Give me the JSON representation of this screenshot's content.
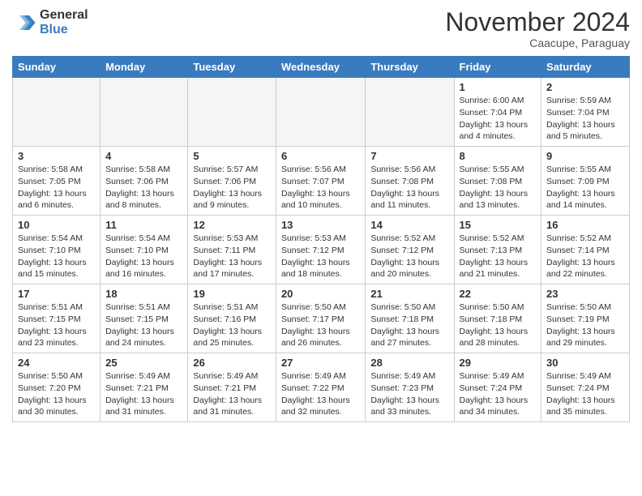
{
  "logo": {
    "general": "General",
    "blue": "Blue"
  },
  "title": "November 2024",
  "subtitle": "Caacupe, Paraguay",
  "days_header": [
    "Sunday",
    "Monday",
    "Tuesday",
    "Wednesday",
    "Thursday",
    "Friday",
    "Saturday"
  ],
  "weeks": [
    [
      {
        "day": "",
        "info": ""
      },
      {
        "day": "",
        "info": ""
      },
      {
        "day": "",
        "info": ""
      },
      {
        "day": "",
        "info": ""
      },
      {
        "day": "",
        "info": ""
      },
      {
        "day": "1",
        "info": "Sunrise: 6:00 AM\nSunset: 7:04 PM\nDaylight: 13 hours\nand 4 minutes."
      },
      {
        "day": "2",
        "info": "Sunrise: 5:59 AM\nSunset: 7:04 PM\nDaylight: 13 hours\nand 5 minutes."
      }
    ],
    [
      {
        "day": "3",
        "info": "Sunrise: 5:58 AM\nSunset: 7:05 PM\nDaylight: 13 hours\nand 6 minutes."
      },
      {
        "day": "4",
        "info": "Sunrise: 5:58 AM\nSunset: 7:06 PM\nDaylight: 13 hours\nand 8 minutes."
      },
      {
        "day": "5",
        "info": "Sunrise: 5:57 AM\nSunset: 7:06 PM\nDaylight: 13 hours\nand 9 minutes."
      },
      {
        "day": "6",
        "info": "Sunrise: 5:56 AM\nSunset: 7:07 PM\nDaylight: 13 hours\nand 10 minutes."
      },
      {
        "day": "7",
        "info": "Sunrise: 5:56 AM\nSunset: 7:08 PM\nDaylight: 13 hours\nand 11 minutes."
      },
      {
        "day": "8",
        "info": "Sunrise: 5:55 AM\nSunset: 7:08 PM\nDaylight: 13 hours\nand 13 minutes."
      },
      {
        "day": "9",
        "info": "Sunrise: 5:55 AM\nSunset: 7:09 PM\nDaylight: 13 hours\nand 14 minutes."
      }
    ],
    [
      {
        "day": "10",
        "info": "Sunrise: 5:54 AM\nSunset: 7:10 PM\nDaylight: 13 hours\nand 15 minutes."
      },
      {
        "day": "11",
        "info": "Sunrise: 5:54 AM\nSunset: 7:10 PM\nDaylight: 13 hours\nand 16 minutes."
      },
      {
        "day": "12",
        "info": "Sunrise: 5:53 AM\nSunset: 7:11 PM\nDaylight: 13 hours\nand 17 minutes."
      },
      {
        "day": "13",
        "info": "Sunrise: 5:53 AM\nSunset: 7:12 PM\nDaylight: 13 hours\nand 18 minutes."
      },
      {
        "day": "14",
        "info": "Sunrise: 5:52 AM\nSunset: 7:12 PM\nDaylight: 13 hours\nand 20 minutes."
      },
      {
        "day": "15",
        "info": "Sunrise: 5:52 AM\nSunset: 7:13 PM\nDaylight: 13 hours\nand 21 minutes."
      },
      {
        "day": "16",
        "info": "Sunrise: 5:52 AM\nSunset: 7:14 PM\nDaylight: 13 hours\nand 22 minutes."
      }
    ],
    [
      {
        "day": "17",
        "info": "Sunrise: 5:51 AM\nSunset: 7:15 PM\nDaylight: 13 hours\nand 23 minutes."
      },
      {
        "day": "18",
        "info": "Sunrise: 5:51 AM\nSunset: 7:15 PM\nDaylight: 13 hours\nand 24 minutes."
      },
      {
        "day": "19",
        "info": "Sunrise: 5:51 AM\nSunset: 7:16 PM\nDaylight: 13 hours\nand 25 minutes."
      },
      {
        "day": "20",
        "info": "Sunrise: 5:50 AM\nSunset: 7:17 PM\nDaylight: 13 hours\nand 26 minutes."
      },
      {
        "day": "21",
        "info": "Sunrise: 5:50 AM\nSunset: 7:18 PM\nDaylight: 13 hours\nand 27 minutes."
      },
      {
        "day": "22",
        "info": "Sunrise: 5:50 AM\nSunset: 7:18 PM\nDaylight: 13 hours\nand 28 minutes."
      },
      {
        "day": "23",
        "info": "Sunrise: 5:50 AM\nSunset: 7:19 PM\nDaylight: 13 hours\nand 29 minutes."
      }
    ],
    [
      {
        "day": "24",
        "info": "Sunrise: 5:50 AM\nSunset: 7:20 PM\nDaylight: 13 hours\nand 30 minutes."
      },
      {
        "day": "25",
        "info": "Sunrise: 5:49 AM\nSunset: 7:21 PM\nDaylight: 13 hours\nand 31 minutes."
      },
      {
        "day": "26",
        "info": "Sunrise: 5:49 AM\nSunset: 7:21 PM\nDaylight: 13 hours\nand 31 minutes."
      },
      {
        "day": "27",
        "info": "Sunrise: 5:49 AM\nSunset: 7:22 PM\nDaylight: 13 hours\nand 32 minutes."
      },
      {
        "day": "28",
        "info": "Sunrise: 5:49 AM\nSunset: 7:23 PM\nDaylight: 13 hours\nand 33 minutes."
      },
      {
        "day": "29",
        "info": "Sunrise: 5:49 AM\nSunset: 7:24 PM\nDaylight: 13 hours\nand 34 minutes."
      },
      {
        "day": "30",
        "info": "Sunrise: 5:49 AM\nSunset: 7:24 PM\nDaylight: 13 hours\nand 35 minutes."
      }
    ]
  ]
}
